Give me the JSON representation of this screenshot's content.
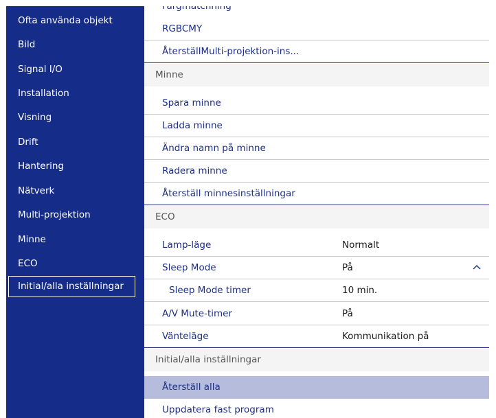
{
  "sidebar": {
    "items": [
      {
        "label": "Ofta använda objekt"
      },
      {
        "label": "Bild"
      },
      {
        "label": "Signal I/O"
      },
      {
        "label": "Installation"
      },
      {
        "label": "Visning"
      },
      {
        "label": "Drift"
      },
      {
        "label": "Hantering"
      },
      {
        "label": "Nätverk"
      },
      {
        "label": "Multi-projektion"
      },
      {
        "label": "Minne"
      },
      {
        "label": "ECO"
      },
      {
        "label": "Initial/alla inställningar",
        "selected": true
      }
    ]
  },
  "panel": {
    "partial_top_label": "Färgmatchning",
    "rows": [
      {
        "label": "RGBCMY"
      },
      {
        "label": "ÅterställMulti-projektion-ins..."
      },
      {
        "label": "Minne",
        "section": true
      },
      {
        "label": "Spara minne"
      },
      {
        "label": "Ladda minne"
      },
      {
        "label": "Ändra namn på minne"
      },
      {
        "label": "Radera minne"
      },
      {
        "label": "Återställ minnesinställningar"
      },
      {
        "label": "ECO",
        "section": true
      },
      {
        "label": "Lamp-läge",
        "value": "Normalt"
      },
      {
        "label": "Sleep Mode",
        "value": "På",
        "icon": "chevron-up-icon"
      },
      {
        "label": "Sleep Mode timer",
        "value": "10 min.",
        "sub": true
      },
      {
        "label": "A/V Mute-timer",
        "value": "På"
      },
      {
        "label": "Vänteläge",
        "value": "Kommunikation på"
      },
      {
        "label": "Initial/alla inställningar",
        "section": true
      },
      {
        "label": "Återställ alla",
        "highlighted": true
      },
      {
        "label": "Uppdatera fast program"
      }
    ]
  },
  "colors": {
    "sidebar_bg": "#152c88",
    "sidebar_text": "#ffffff",
    "item_text": "#1d2f86",
    "highlight_bg": "#b5bcdc",
    "section_text": "#555555"
  }
}
